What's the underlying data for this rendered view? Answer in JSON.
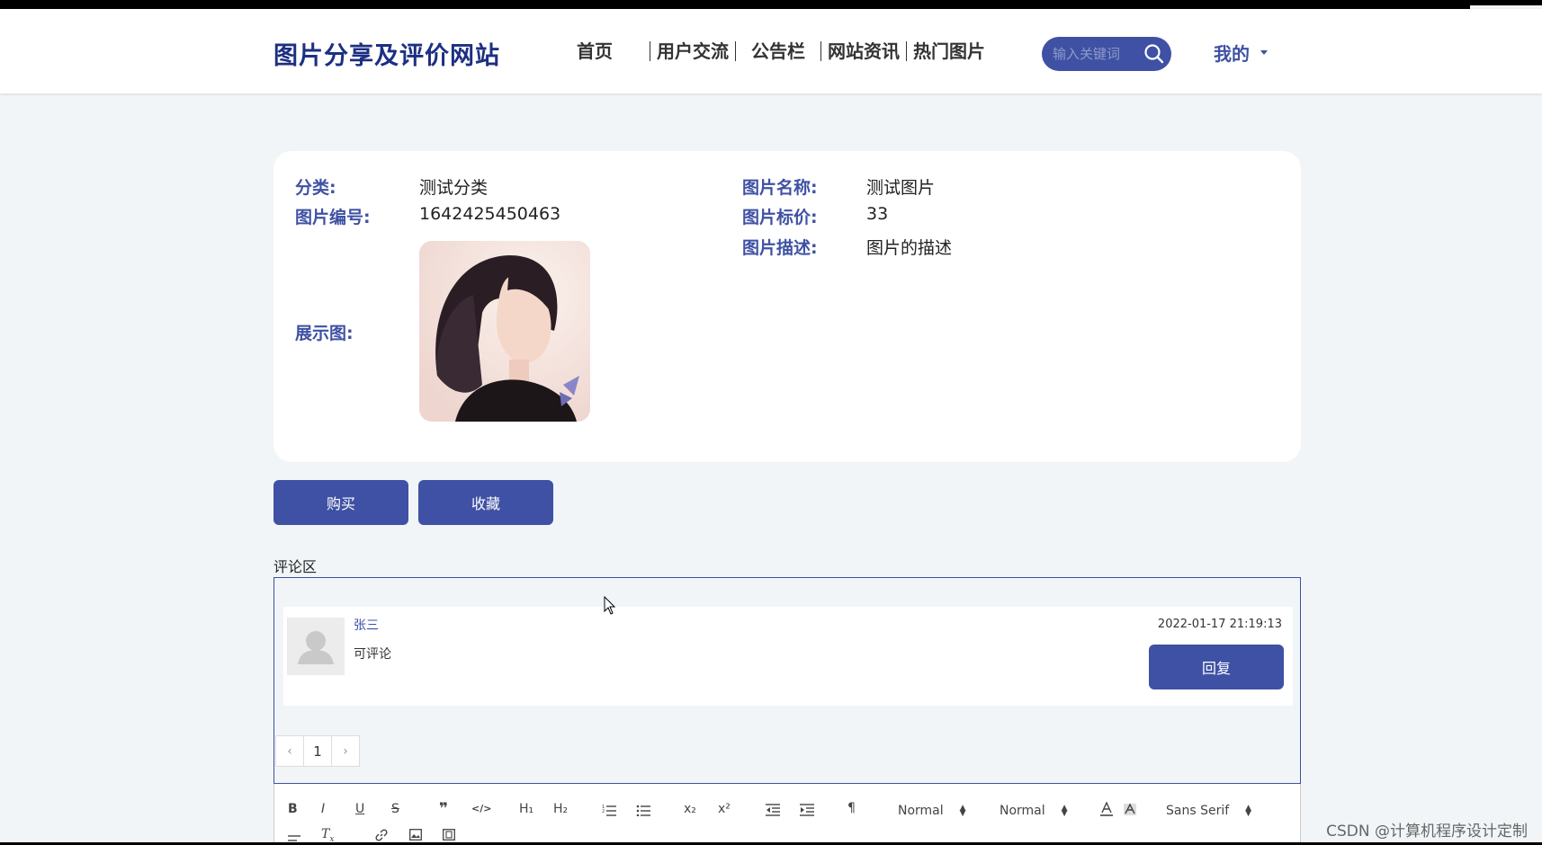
{
  "header": {
    "logo": "图片分享及评价网站",
    "nav": [
      "首页",
      "用户交流",
      "公告栏",
      "网站资讯",
      "热门图片"
    ],
    "search_placeholder": "输入关键词",
    "user_menu": "我的"
  },
  "detail": {
    "category_label": "分类:",
    "category_value": "测试分类",
    "code_label": "图片编号:",
    "code_value": "1642425450463",
    "preview_label": "展示图:",
    "name_label": "图片名称:",
    "name_value": "测试图片",
    "price_label": "图片标价:",
    "price_value": "33",
    "desc_label": "图片描述:",
    "desc_value": "图片的描述"
  },
  "actions": {
    "buy": "购买",
    "favorite": "收藏"
  },
  "comments": {
    "title": "评论区",
    "items": [
      {
        "user": "张三",
        "text": "可评论",
        "time": "2022-01-17 21:19:13",
        "reply": "回复"
      }
    ],
    "pager": {
      "prev": "‹",
      "page": "1",
      "next": "›"
    }
  },
  "editor": {
    "tools": [
      "B",
      "I",
      "U",
      "S",
      "❞",
      "</>",
      "H₁",
      "H₂",
      "x₂",
      "x²",
      "¶"
    ],
    "size_select": "Normal",
    "header_select": "Normal",
    "font_select": "Sans Serif"
  },
  "watermark": "CSDN @计算机程序设计定制",
  "colors": {
    "accent": "#3f51a4",
    "logo": "#1d2f82",
    "background": "#f1f5f7"
  }
}
